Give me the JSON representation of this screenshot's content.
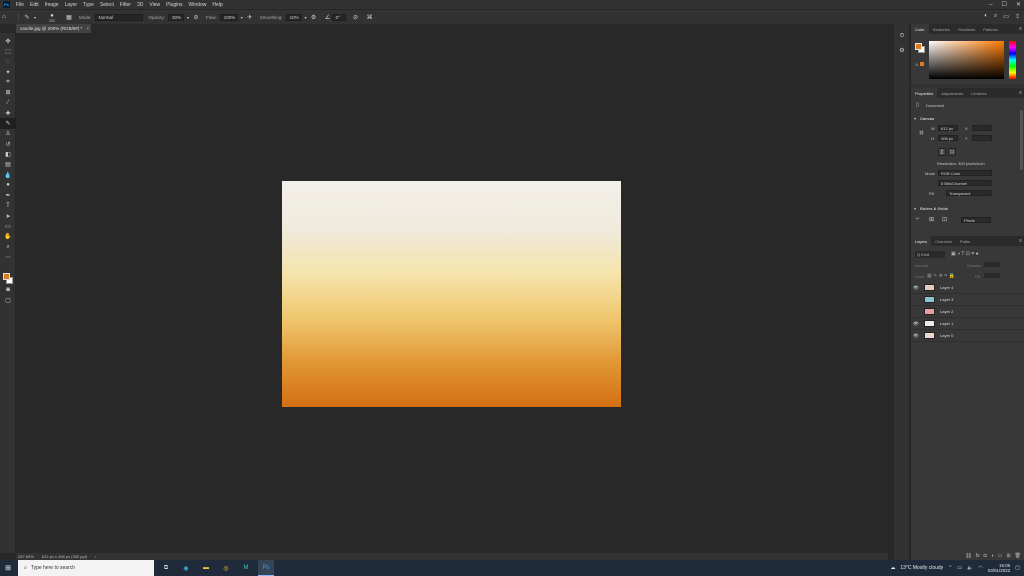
{
  "menubar": {
    "logo": "Ps",
    "items": [
      "File",
      "Edit",
      "Image",
      "Layer",
      "Type",
      "Select",
      "Filter",
      "3D",
      "View",
      "Plugins",
      "Window",
      "Help"
    ]
  },
  "options": {
    "brush_size": "232",
    "mode_label": "Mode:",
    "mode_value": "Normal",
    "opacity_label": "Opacity:",
    "opacity_value": "30%",
    "flow_label": "Flow:",
    "flow_value": "100%",
    "smoothing_label": "Smoothing:",
    "smoothing_value": "10%",
    "angle_value": "0°"
  },
  "document": {
    "tab_title": "candle.jpg @ 200% (RGB/8#) *",
    "close": "×"
  },
  "status": {
    "zoom": "287.69%",
    "size": "612 px x 408 px (300 ppi)",
    "arrow": "›"
  },
  "color_panel": {
    "tabs": [
      "Color",
      "Swatches",
      "Gradients",
      "Patterns"
    ],
    "warn": "⚠"
  },
  "properties_panel": {
    "tabs": [
      "Properties",
      "Adjustments",
      "Libraries"
    ],
    "doc_label": "Document",
    "canvas_header": "Canvas",
    "w_label": "W",
    "w_value": "612 px",
    "x_label": "X",
    "h_label": "H",
    "h_value": "408 px",
    "y_label": "Y",
    "resolution": "Resolution: 300 pixels/inch",
    "mode_label": "Mode",
    "mode_value": "RGB Color",
    "depth_value": "8 Bits/Channel",
    "fill_label": "Fill",
    "fill_value": "Transparent",
    "rulers_header": "Rulers & Grids",
    "units_value": "Pixels"
  },
  "layers_panel": {
    "tabs": [
      "Layers",
      "Channels",
      "Paths"
    ],
    "kind": "Q Kind",
    "mode": "Normal",
    "opacity_label": "Opacity:",
    "lock_label": "Lock:",
    "fill_label": "Fill:",
    "layers": [
      {
        "name": "Layer 4",
        "visible": true,
        "thumb": "#e9c9b8"
      },
      {
        "name": "Layer 3",
        "visible": false,
        "thumb": "#8fc5d1"
      },
      {
        "name": "Layer 2",
        "visible": false,
        "thumb": "#e6a0a4"
      },
      {
        "name": "Layer 1",
        "visible": true,
        "thumb": "#ecebe6"
      },
      {
        "name": "Layer 0",
        "visible": true,
        "thumb": "#f0d4cf"
      }
    ]
  },
  "taskbar": {
    "search_placeholder": "Type here to search",
    "weather": "13°C  Mostly cloudy",
    "time": "15:05",
    "date": "03/01/2022"
  }
}
